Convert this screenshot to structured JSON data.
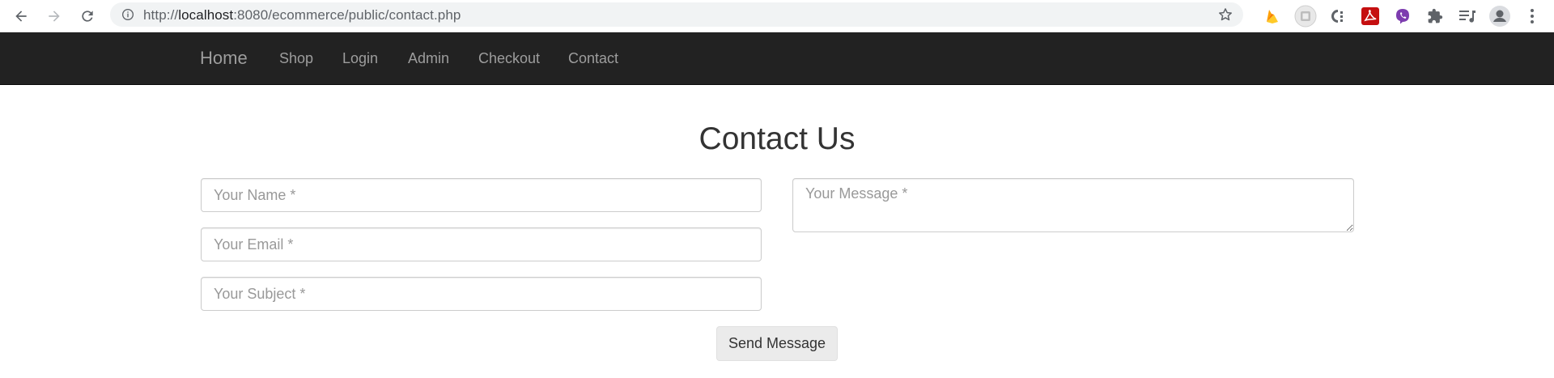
{
  "browser": {
    "url_scheme": "http://",
    "url_host": "localhost",
    "url_path": ":8080/ecommerce/public/contact.php"
  },
  "navbar": {
    "brand": "Home",
    "links": [
      "Shop",
      "Login",
      "Admin",
      "Checkout",
      "Contact"
    ],
    "background": "#222222",
    "link_color": "#9d9d9d"
  },
  "page": {
    "title": "Contact Us"
  },
  "form": {
    "name_placeholder": "Your Name *",
    "email_placeholder": "Your Email *",
    "subject_placeholder": "Your Subject *",
    "message_placeholder": "Your Message *",
    "submit_label": "Send Message"
  },
  "icons": {
    "back": "arrow-left-icon",
    "forward": "arrow-right-icon",
    "reload": "reload-icon",
    "info": "info-icon",
    "bookmark": "star-icon",
    "extensions": [
      "firebase-icon",
      "tracker-icon",
      "c-extension-icon",
      "pdf-icon",
      "viber-icon",
      "puzzle-icon",
      "reading-list-icon",
      "profile-icon",
      "menu-icon"
    ]
  }
}
